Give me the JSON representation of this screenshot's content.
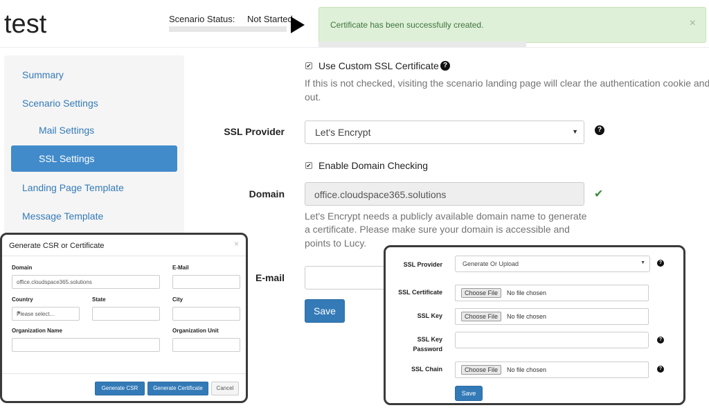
{
  "header": {
    "title": "test",
    "status_label": "Scenario Status:",
    "status_value": "Not Started"
  },
  "alert": {
    "message": "Certificate has been successfully created.",
    "close": "×"
  },
  "sidebar": {
    "items": [
      {
        "label": "Summary"
      },
      {
        "label": "Scenario Settings"
      },
      {
        "label": "Mail Settings"
      },
      {
        "label": "SSL Settings"
      },
      {
        "label": "Landing Page Template"
      },
      {
        "label": "Message Template"
      }
    ]
  },
  "form": {
    "use_custom_ssl_label": "Use Custom SSL Certificate",
    "use_custom_ssl_checked": true,
    "help_text_1": "If this is not checked, visiting the scenario landing page will clear the authentication cookie and y",
    "help_text_1b": "out.",
    "ssl_provider_label": "SSL Provider",
    "ssl_provider_value": "Let's Encrypt",
    "enable_domain_label": "Enable Domain Checking",
    "enable_domain_checked": true,
    "domain_label": "Domain",
    "domain_value": "office.cloudspace365.solutions",
    "domain_help_1": "Let's Encrypt needs a publicly available domain name to generate",
    "domain_help_2": "a certificate. Please make sure your domain is accessible and",
    "domain_help_3": "points to Lucy.",
    "email_label": "E-mail",
    "save_label": "Save",
    "help_glyph": "?",
    "check_glyph": "✔",
    "checkbox_glyph": "✔"
  },
  "csr_modal": {
    "title": "Generate CSR or Certificate",
    "close": "×",
    "domain_label": "Domain",
    "domain_value": "office.cloudspace365.solutions",
    "email_label": "E-Mail",
    "country_label": "Country",
    "country_value": "Please select...",
    "state_label": "State",
    "city_label": "City",
    "org_name_label": "Organization Name",
    "org_unit_label": "Organization Unit",
    "generate_csr_label": "Generate CSR",
    "generate_cert_label": "Generate Certificate",
    "cancel_label": "Cancel"
  },
  "ssl_modal": {
    "provider_label": "SSL Provider",
    "provider_value": "Generate Or Upload",
    "cert_label": "SSL Certificate",
    "key_label": "SSL Key",
    "key_password_label_1": "SSL Key",
    "key_password_label_2": "Password",
    "chain_label": "SSL Chain",
    "choose_file_label": "Choose File",
    "no_file_text": "No file chosen",
    "save_label": "Save"
  }
}
